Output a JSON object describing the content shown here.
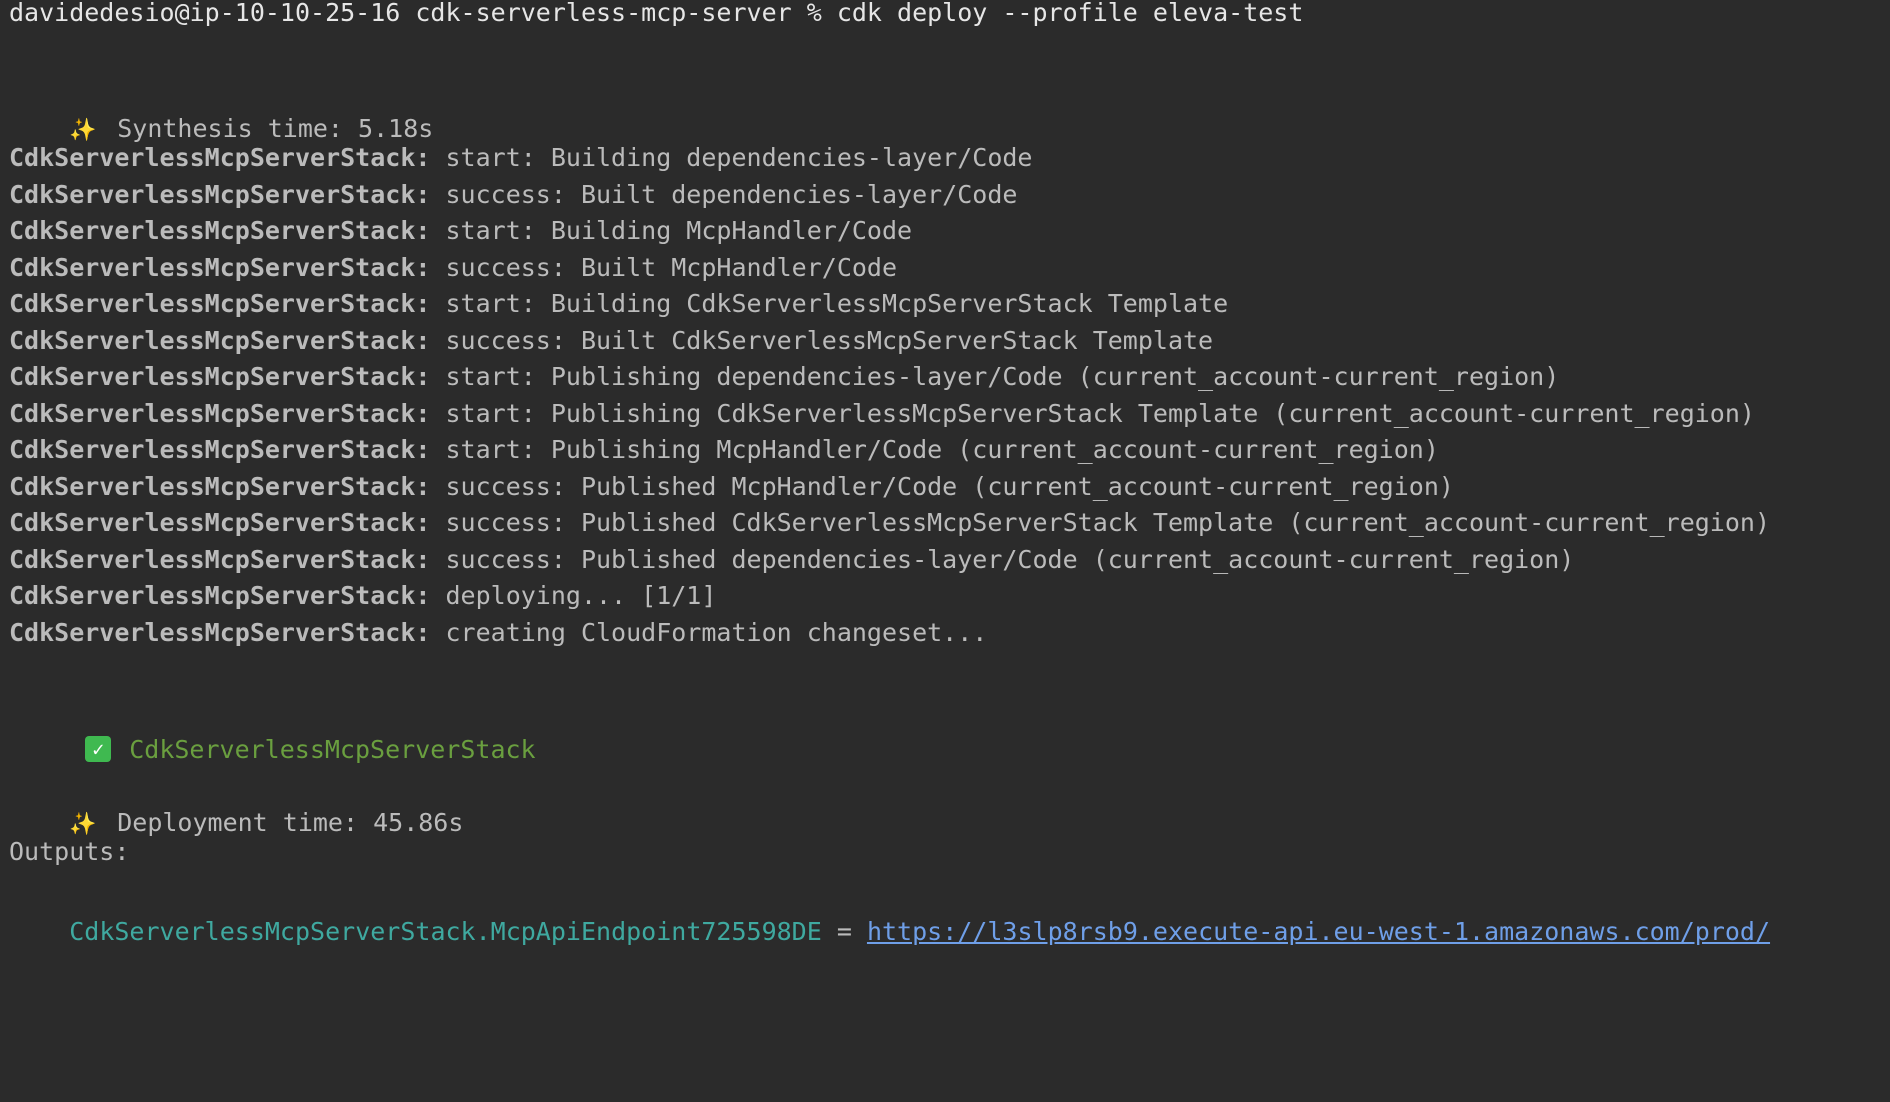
{
  "prompt": {
    "text": "davidedesio@ip-10-10-25-16 cdk-serverless-mcp-server % cdk deploy --profile eleva-test"
  },
  "synthesis": {
    "icon": "sparkles-icon",
    "text": "Synthesis time: 5.18s"
  },
  "log": {
    "stack_prefix": "CdkServerlessMcpServerStack:",
    "lines": [
      " start: Building dependencies-layer/Code",
      " success: Built dependencies-layer/Code",
      " start: Building McpHandler/Code",
      " success: Built McpHandler/Code",
      " start: Building CdkServerlessMcpServerStack Template",
      " success: Built CdkServerlessMcpServerStack Template",
      " start: Publishing dependencies-layer/Code (current_account-current_region)",
      " start: Publishing CdkServerlessMcpServerStack Template (current_account-current_region)",
      " start: Publishing McpHandler/Code (current_account-current_region)",
      " success: Published McpHandler/Code (current_account-current_region)",
      " success: Published CdkServerlessMcpServerStack Template (current_account-current_region)",
      " success: Published dependencies-layer/Code (current_account-current_region)",
      " deploying... [1/1]",
      " creating CloudFormation changeset..."
    ]
  },
  "result": {
    "icon": "check-mark-button-icon",
    "stack_name": "CdkServerlessMcpServerStack",
    "color": "#6a9f3f"
  },
  "deployment": {
    "icon": "sparkles-icon",
    "text": "Deployment time: 45.86s"
  },
  "outputs": {
    "header": "Outputs:",
    "key": "CdkServerlessMcpServerStack.McpApiEndpoint725598DE",
    "separator": " = ",
    "url": "https://l3slp8rsb9.execute-api.eu-west-1.amazonaws.com/prod/",
    "key_color": "#3fa9a0",
    "url_color": "#6f9fe8"
  },
  "colors": {
    "background": "#2b2b2b",
    "text": "#bbbbbb"
  }
}
